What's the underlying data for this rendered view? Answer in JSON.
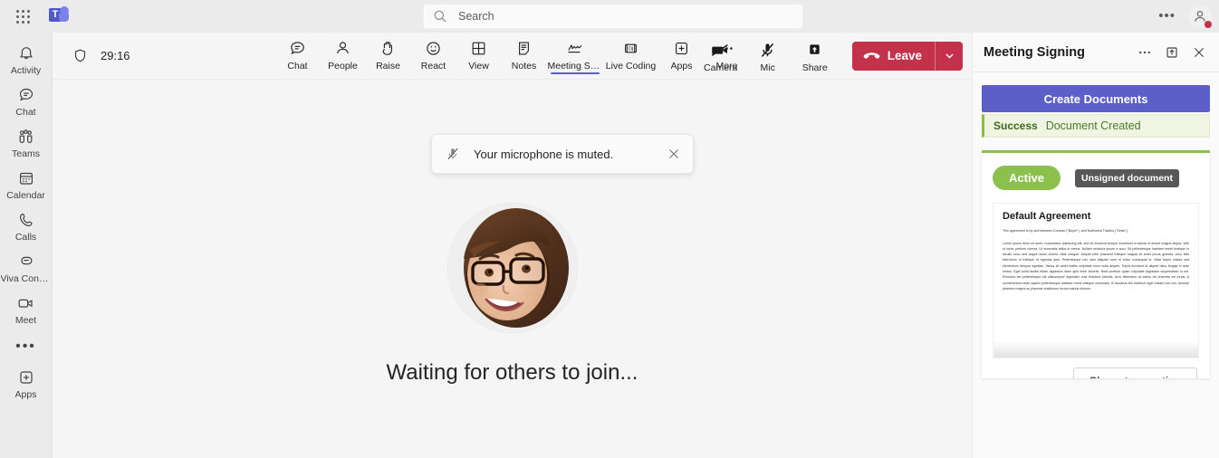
{
  "topbar": {
    "app_launcher": "App launcher",
    "brand": "Microsoft Teams",
    "brand_letter": "T",
    "search": {
      "placeholder": "Search",
      "value": "",
      "icon": "search-icon"
    },
    "more_label": "•••",
    "account_icon": "person-icon",
    "status_color": "#c4314b"
  },
  "rail": {
    "items": [
      {
        "label": "Activity",
        "icon": "bell-icon"
      },
      {
        "label": "Chat",
        "icon": "chat-bubble-icon"
      },
      {
        "label": "Teams",
        "icon": "people-group-icon"
      },
      {
        "label": "Calendar",
        "icon": "calendar-icon"
      },
      {
        "label": "Calls",
        "icon": "phone-icon"
      },
      {
        "label": "Viva Conne...",
        "icon": "viva-connections-icon"
      },
      {
        "label": "Meet",
        "icon": "video-camera-icon"
      }
    ],
    "more": "•••",
    "apps": {
      "label": "Apps",
      "icon": "plus-box-icon"
    }
  },
  "meetingbar": {
    "shield_icon": "shield-icon",
    "timer": "29:16",
    "tools": [
      {
        "label": "Chat",
        "icon": "chat-bubble-icon",
        "active": false
      },
      {
        "label": "People",
        "icon": "person-icon",
        "active": false
      },
      {
        "label": "Raise",
        "icon": "raise-hand-icon",
        "active": false
      },
      {
        "label": "React",
        "icon": "smiley-icon",
        "active": false
      },
      {
        "label": "View",
        "icon": "grid-view-icon",
        "active": false
      },
      {
        "label": "Notes",
        "icon": "notes-icon",
        "active": false
      },
      {
        "label": "Meeting Sig...",
        "icon": "signature-icon",
        "active": true
      },
      {
        "label": "Live Coding",
        "icon": "live-coding-icon",
        "active": false
      },
      {
        "label": "Apps",
        "icon": "plus-box-icon",
        "active": false
      },
      {
        "label": "More",
        "icon": "ellipsis-icon",
        "active": false
      }
    ],
    "right_controls": [
      {
        "label": "Camera",
        "icon": "camera-off-icon",
        "muted": true
      },
      {
        "label": "Mic",
        "icon": "mic-off-icon",
        "muted": true
      },
      {
        "label": "Share",
        "icon": "share-up-icon",
        "muted": false
      }
    ],
    "leave": {
      "label": "Leave",
      "icon": "hangup-icon",
      "chevron": "chevron-down-icon",
      "color": "#c4314b"
    }
  },
  "stage": {
    "toast": {
      "icon": "mic-off-icon",
      "text": "Your microphone is muted.",
      "close_icon": "close-icon"
    },
    "avatar_alt": "Participant avatar",
    "waiting_text": "Waiting for others to join..."
  },
  "panel": {
    "title": "Meeting Signing",
    "header_icons": [
      {
        "name": "more-options-icon",
        "glyph": "•••"
      },
      {
        "name": "popout-icon",
        "glyph": "↑"
      },
      {
        "name": "close-icon",
        "glyph": "✕"
      }
    ],
    "create_button": "Create Documents",
    "status": {
      "label": "Success",
      "message": "Document Created",
      "color": "#8cc04d"
    },
    "document": {
      "state_pill": "Active",
      "signature_badge": "Unsigned document",
      "title": "Default Agreement",
      "lead": "This agreement is by and between Contoso (\"Buyer\"), and Northwind Traders (\"Seller\").",
      "body": "Lorem ipsum dolor sit amet, consectetur adipiscing elit, sed do eiusmod tempor incididunt ut labore et dolore magna aliqua. Velit ut tortor pretium viverra. Ut venenatis tellus in metus. Nullam vehicula ipsum a arcu. Sit pellentesque habitant morbi tristique in iaculis nunc sed augue lacus viverra vitae congue. Aliquet nibh praesent tristique magna sit amet purus gravida. Arcu felis bibendum ut tristique et egestas quis. Pellentesque nec nam aliquam sem et tortor consequat id. Vitae turpis massa sed elementum tempus egestas. Varius sit amet mattis vulputate enim nulla aliquet. Turpis tincidunt id aliquet risus feugiat in ante metus. Eget nulla facilisi etiam dignissim diam quis enim lobortis. Nisei pretium quam vulputate dignissim suspendisse in est. Rhoncus est pellentesque elit ullamcorper dignissim cras tincidunt lobortis. Arcu bibendum at varius vel pharetra vel turpis. A condimentum vitae sapien pellentesque habitant morbi tristique venenatis. Id faucibus nisl tincidunt eget nullam non nisi. Aenean pharetra magna ac placerat vestibulum lectus mauris ultrices."
    },
    "share_button": "Share to meeting"
  }
}
